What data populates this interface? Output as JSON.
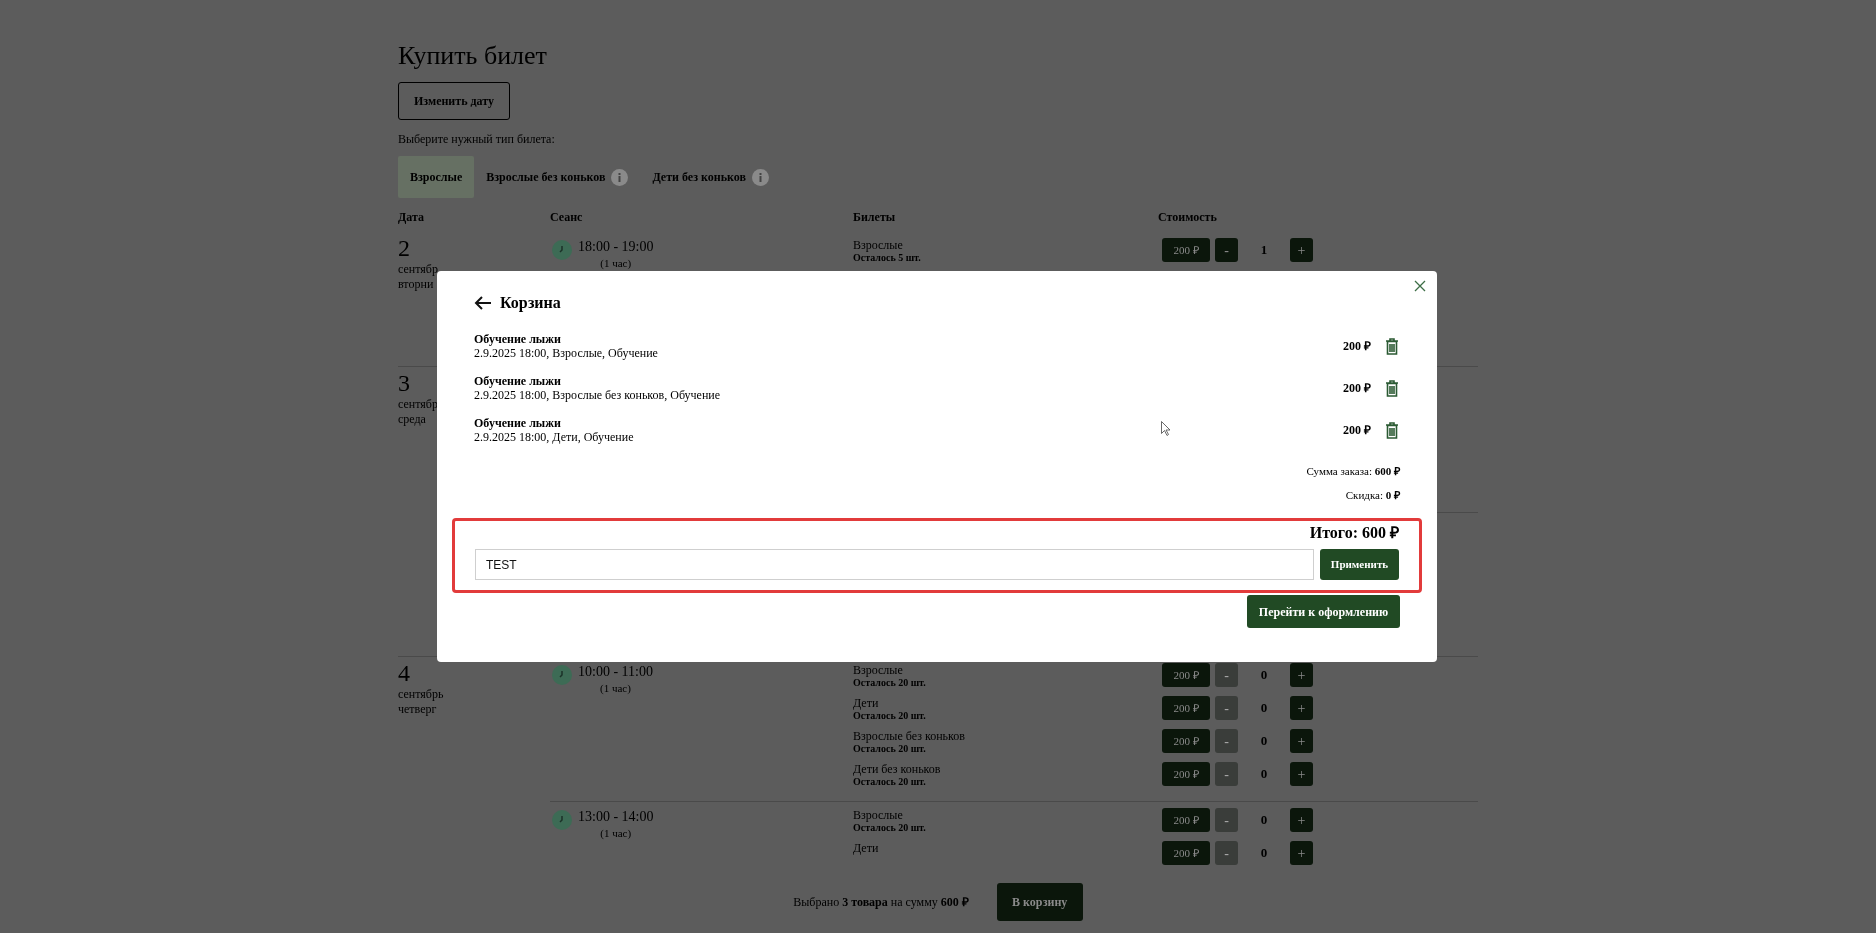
{
  "page": {
    "title": "Купить билет",
    "change_date_button": "Изменить дату",
    "prompt": "Выберите нужный тип билета:",
    "ticket_types": [
      {
        "label": "Взрослые",
        "selected": true,
        "info": false
      },
      {
        "label": "Взрослые без коньков",
        "selected": false,
        "info": true
      },
      {
        "label": "Дети без коньков",
        "selected": false,
        "info": true
      }
    ],
    "columns": [
      "Дата",
      "Сеанс",
      "Билеты",
      "Стоимость"
    ],
    "decrease_label": "-",
    "increase_label": "+",
    "days": [
      {
        "day": "2",
        "month": "сентябр",
        "weekday": "вторни",
        "sessions": [
          {
            "time": "18:00 - 19:00",
            "duration": "(1 час)",
            "tickets": [
              {
                "name": "Взрослые",
                "remaining": "Осталось 5 шт.",
                "price": "200 ₽",
                "quantity": "1",
                "minus_disabled": false
              }
            ]
          }
        ]
      },
      {
        "day": "3",
        "month": "сентябр",
        "weekday": "среда"
      },
      {
        "day": "4",
        "month": "сентябрь",
        "weekday": "четверг",
        "sessions": [
          {
            "time": "10:00 - 11:00",
            "duration": "(1 час)",
            "tickets": [
              {
                "name": "Взрослые",
                "remaining": "Осталось 20 шт.",
                "price": "200 ₽",
                "quantity": "0",
                "minus_disabled": true
              },
              {
                "name": "Дети",
                "remaining": "Осталось 20 шт.",
                "price": "200 ₽",
                "quantity": "0",
                "minus_disabled": true
              },
              {
                "name": "Взрослые без коньков",
                "remaining": "Осталось 20 шт.",
                "price": "200 ₽",
                "quantity": "0",
                "minus_disabled": true
              },
              {
                "name": "Дети без коньков",
                "remaining": "Осталось 20 шт.",
                "price": "200 ₽",
                "quantity": "0",
                "minus_disabled": true
              }
            ]
          },
          {
            "time": "13:00 - 14:00",
            "duration": "(1 час)",
            "tickets": [
              {
                "name": "Взрослые",
                "remaining": "Осталось 20 шт.",
                "price": "200 ₽",
                "quantity": "0",
                "minus_disabled": true
              },
              {
                "name": "Дети",
                "price": "200 ₽",
                "quantity": "0",
                "minus_disabled": true
              }
            ]
          }
        ]
      }
    ],
    "footer": {
      "summary": "Выбрано **3 товара** на сумму **600  ₽**",
      "button": "В корзину"
    }
  },
  "cart": {
    "title": "Корзина",
    "items": [
      {
        "title": "Обучение лыжи",
        "details": "2.9.2025 18:00, Взрослые, Обучение",
        "price": "200 ₽"
      },
      {
        "title": "Обучение лыжи",
        "details": "2.9.2025 18:00, Взрослые без коньков, Обучение",
        "price": "200 ₽"
      },
      {
        "title": "Обучение лыжи",
        "details": "2.9.2025 18:00, Дети, Обучение",
        "price": "200 ₽"
      }
    ],
    "sum": "Сумма заказа: **600 ₽**",
    "discount": "Скидка: **0 ₽**",
    "total": "Итого: 600 ₽",
    "promo_value": "TEST",
    "apply_button": "Применить",
    "checkout_button": "Перейти к оформлению"
  }
}
